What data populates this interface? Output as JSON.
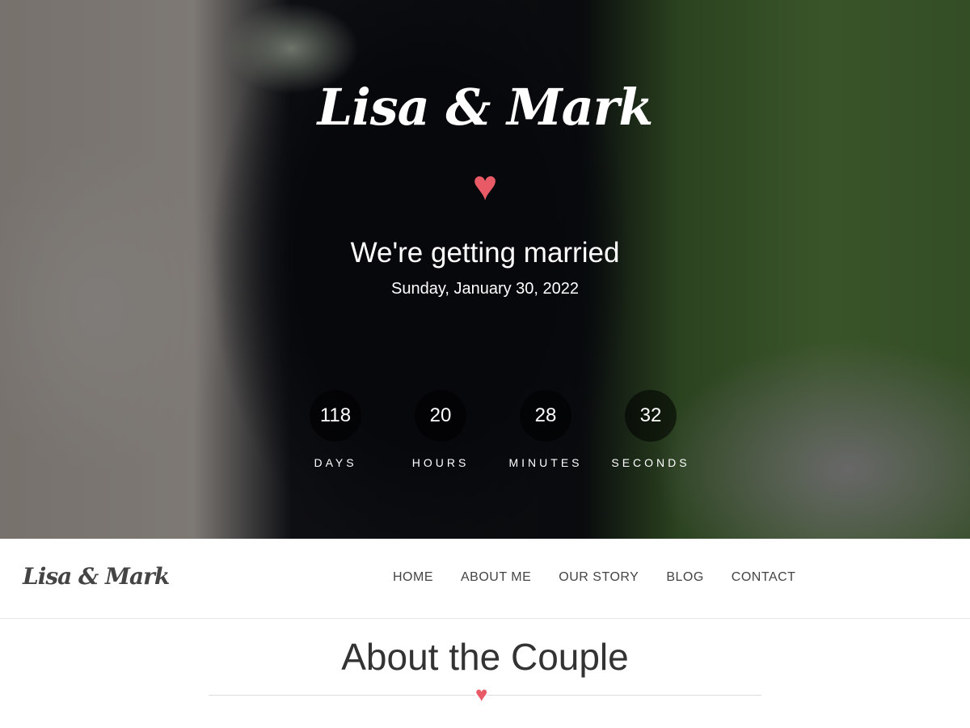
{
  "hero": {
    "title": "Lisa & Mark",
    "tagline": "We're getting married",
    "date": "Sunday, January 30, 2022",
    "countdown": [
      {
        "value": "118",
        "label": "DAYS"
      },
      {
        "value": "20",
        "label": "HOURS"
      },
      {
        "value": "28",
        "label": "MINUTES"
      },
      {
        "value": "32",
        "label": "SECONDS"
      }
    ]
  },
  "navbar": {
    "logo": "Lisa & Mark",
    "items": [
      "HOME",
      "ABOUT ME",
      "OUR STORY",
      "BLOG",
      "CONTACT"
    ]
  },
  "about": {
    "title": "About the Couple"
  },
  "icons": {
    "heart": "♥"
  },
  "colors": {
    "accent": "#e85a66"
  }
}
